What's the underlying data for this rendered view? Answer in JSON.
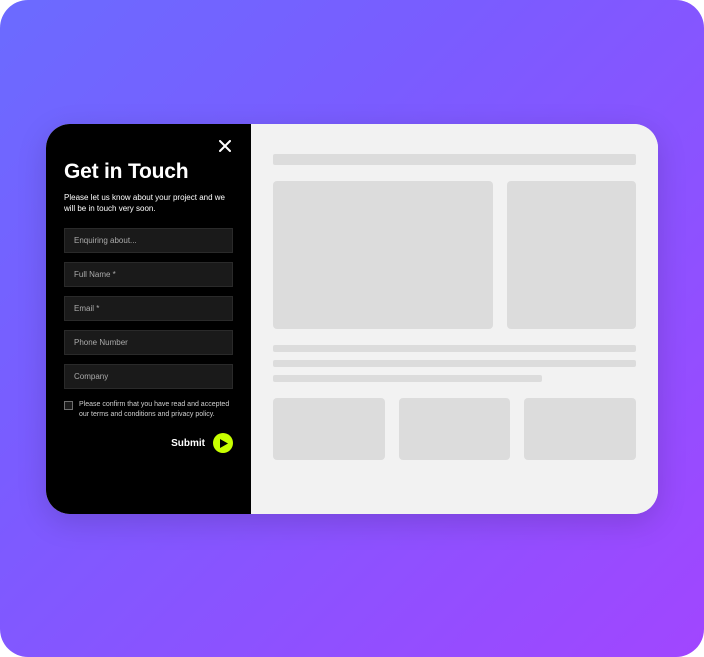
{
  "form": {
    "title": "Get in Touch",
    "subtitle": "Please let us know about your project and we will be in touch very soon.",
    "fields": {
      "enquiry": {
        "placeholder": "Enquiring about..."
      },
      "fullname": {
        "placeholder": "Full Name *"
      },
      "email": {
        "placeholder": "Email *"
      },
      "phone": {
        "placeholder": "Phone Number"
      },
      "company": {
        "placeholder": "Company"
      }
    },
    "consent": "Please confirm that you have read and accepted our terms and conditions and privacy policy.",
    "submit": "Submit"
  }
}
